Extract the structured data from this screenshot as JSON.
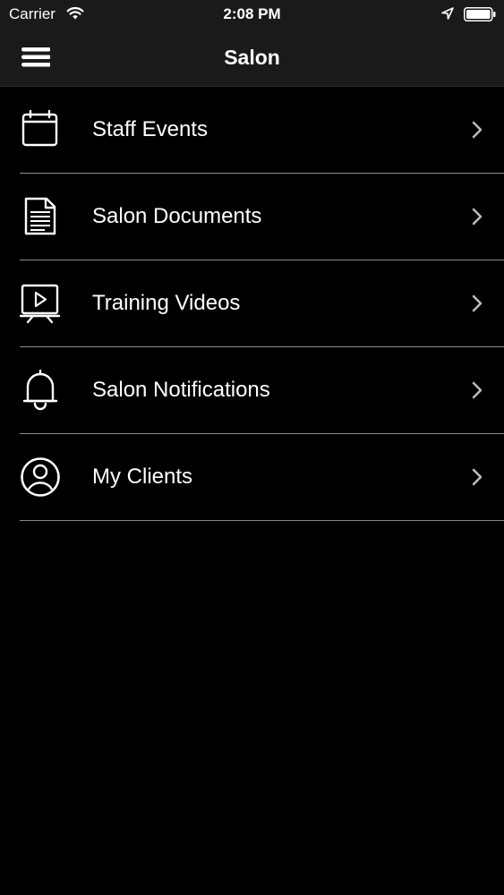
{
  "status_bar": {
    "carrier": "Carrier",
    "time": "2:08 PM",
    "wifi_icon": "wifi-icon",
    "location_icon": "location-arrow-icon",
    "battery_icon": "battery-full-icon"
  },
  "nav": {
    "title": "Salon",
    "menu_icon": "hamburger-menu-icon"
  },
  "menu": {
    "items": [
      {
        "label": "Staff Events",
        "icon": "calendar-icon"
      },
      {
        "label": "Salon Documents",
        "icon": "document-icon"
      },
      {
        "label": "Training Videos",
        "icon": "video-presentation-icon"
      },
      {
        "label": "Salon Notifications",
        "icon": "bell-icon"
      },
      {
        "label": "My Clients",
        "icon": "user-circle-icon"
      }
    ],
    "chevron_icon": "chevron-right-icon"
  },
  "colors": {
    "background": "#000000",
    "bar_background": "#1a1a1a",
    "divider": "#8a8a8a",
    "text": "#ffffff",
    "chevron": "#bdbdbd"
  }
}
